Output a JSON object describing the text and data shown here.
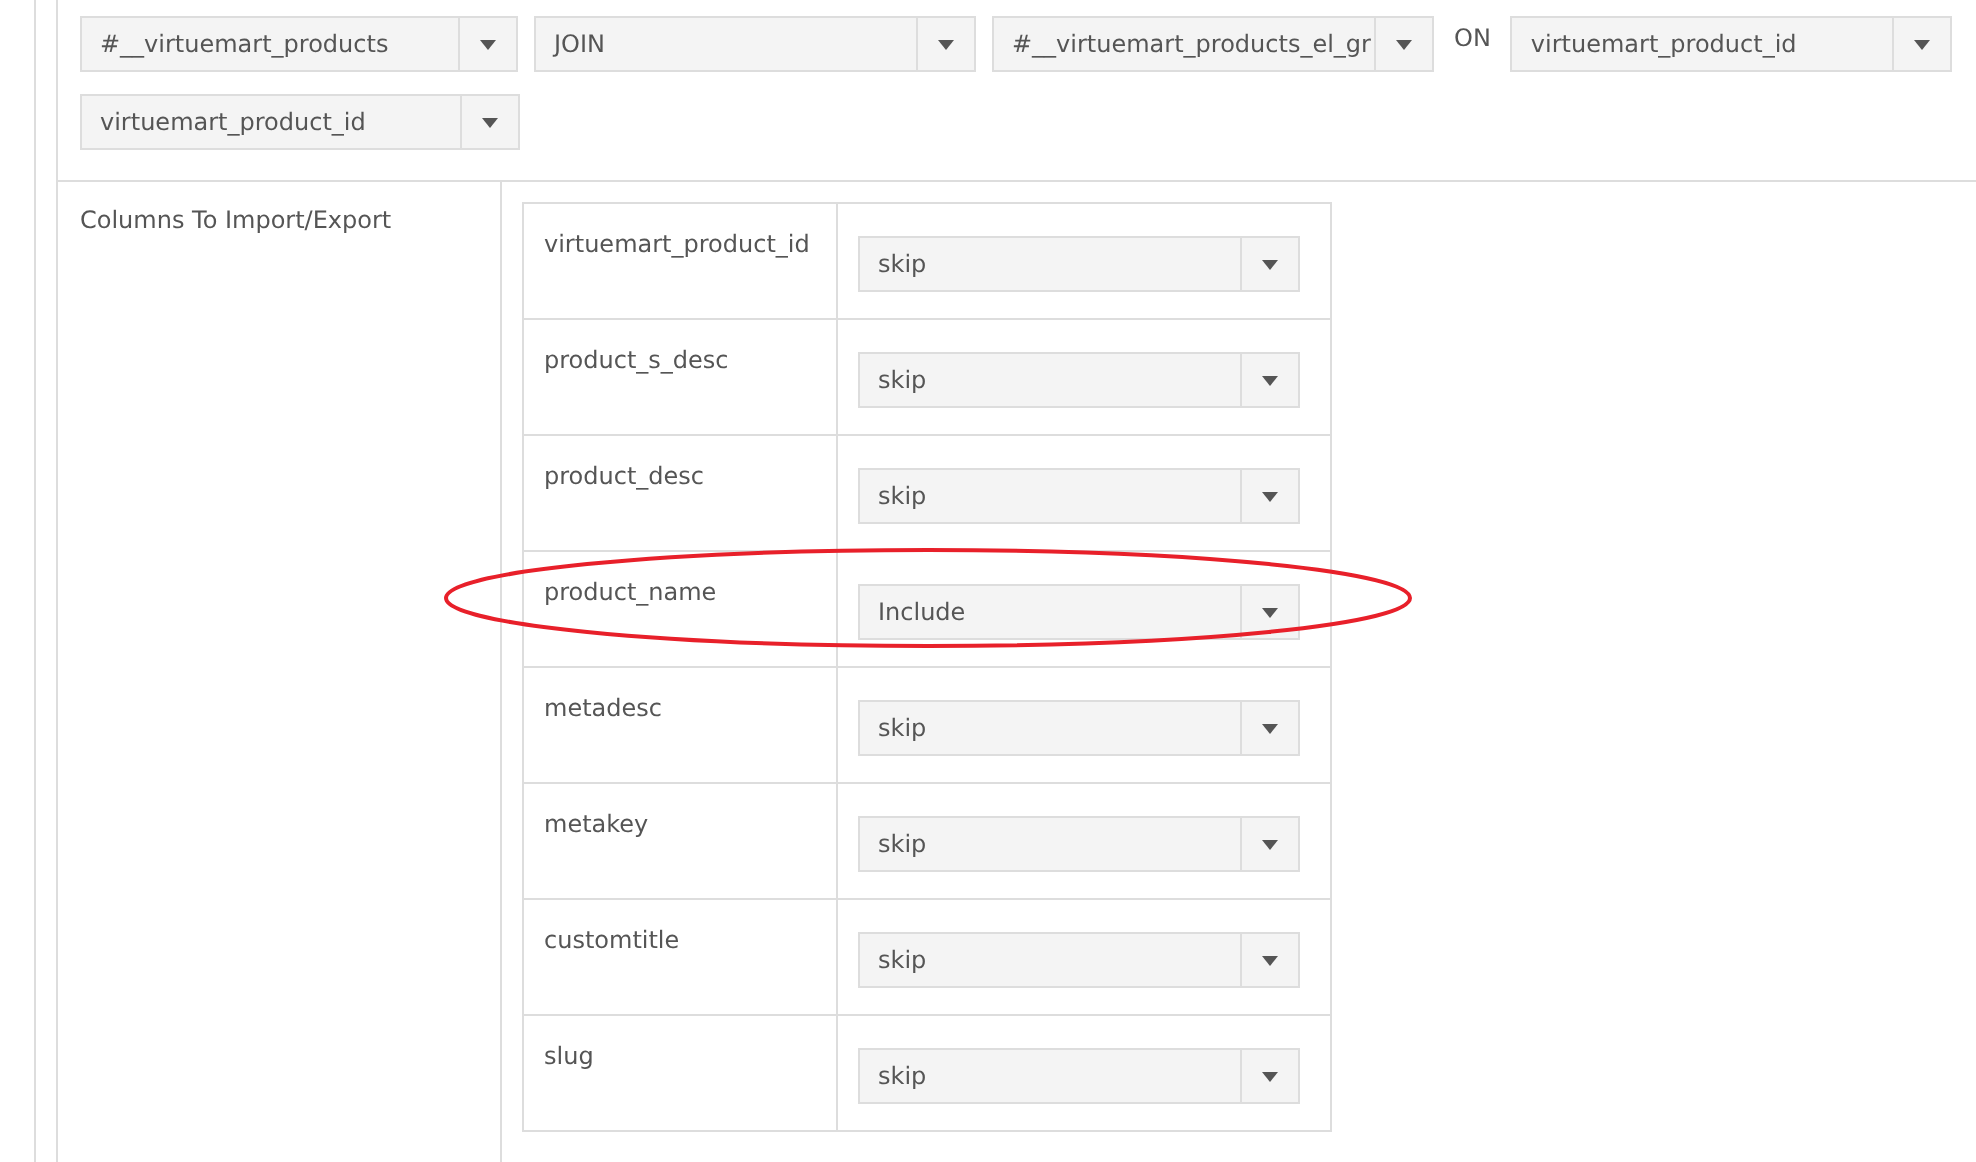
{
  "join": {
    "items": [
      {
        "kind": "select",
        "value": "#__virtuemart_products"
      },
      {
        "kind": "select",
        "value": "JOIN"
      },
      {
        "kind": "select",
        "value": "#__virtuemart_products_el_gr"
      },
      {
        "kind": "text",
        "value": "ON"
      },
      {
        "kind": "select",
        "value": "virtuemart_product_id"
      },
      {
        "kind": "select",
        "value": "virtuemart_product_id"
      }
    ]
  },
  "columns_section": {
    "label": "Columns To Import/Export",
    "rows": [
      {
        "column": "virtuemart_product_id",
        "action": "skip",
        "highlighted": false
      },
      {
        "column": "product_s_desc",
        "action": "skip",
        "highlighted": false
      },
      {
        "column": "product_desc",
        "action": "skip",
        "highlighted": false
      },
      {
        "column": "product_name",
        "action": "Include",
        "highlighted": true
      },
      {
        "column": "metadesc",
        "action": "skip",
        "highlighted": false
      },
      {
        "column": "metakey",
        "action": "skip",
        "highlighted": false
      },
      {
        "column": "customtitle",
        "action": "skip",
        "highlighted": false
      },
      {
        "column": "slug",
        "action": "skip",
        "highlighted": false
      }
    ]
  }
}
